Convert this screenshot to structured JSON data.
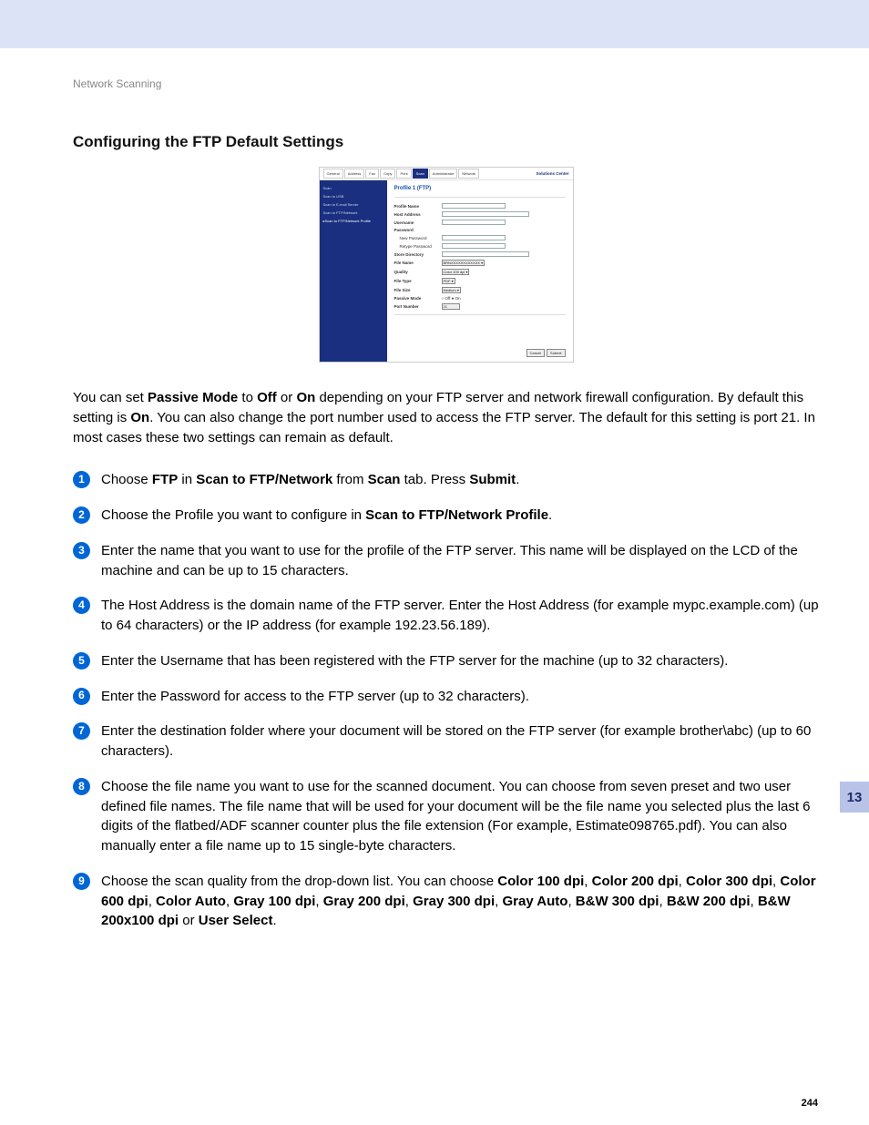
{
  "breadcrumb": "Network Scanning",
  "heading": "Configuring the FTP Default Settings",
  "side_tab": "13",
  "page_number": "244",
  "screenshot_ui": {
    "tabs": [
      "General",
      "Address",
      "Fax",
      "Copy",
      "Print",
      "Scan",
      "Administrator",
      "Network"
    ],
    "active_tab": "Scan",
    "logo": "Solutions Center",
    "sidebar": [
      "Scan",
      "Scan to USB",
      "Scan to E-mail Server",
      "Scan to FTP/Network",
      "▸Scan to FTP/Network Profile"
    ],
    "panel_title": "Profile 1 (FTP)",
    "fields": {
      "profile_name_lbl": "Profile Name",
      "host_address_lbl": "Host Address",
      "username_lbl": "Username",
      "password_lbl": "Password",
      "new_password_lbl": "New Password",
      "retype_password_lbl": "Retype Password",
      "store_directory_lbl": "Store Directory",
      "file_name_lbl": "File Name",
      "file_name_val": "BRNXXXXXXXXXXXX ▾",
      "quality_lbl": "Quality",
      "quality_val": "Color 100 dpi ▾",
      "file_type_lbl": "File Type",
      "file_type_val": "PDF ▾",
      "file_size_lbl": "File Size",
      "file_size_val": "Medium ▾",
      "passive_mode_lbl": "Passive Mode",
      "passive_mode_val": "○ Off  ● On",
      "port_number_lbl": "Port Number",
      "port_number_val": "21"
    },
    "buttons": {
      "cancel": "Cancel",
      "submit": "Submit"
    }
  },
  "intro_pre": "You can set ",
  "intro_b1": "Passive Mode",
  "intro_mid1": " to ",
  "intro_b2": "Off",
  "intro_mid2": " or ",
  "intro_b3": "On",
  "intro_mid3": " depending on your FTP server and network firewall configuration. By default this setting is ",
  "intro_b4": "On",
  "intro_post": ". You can also change the port number used to access the FTP server. The default for this setting is port 21. In most cases these two settings can remain as default.",
  "steps": {
    "s1": {
      "a": "Choose ",
      "b1": "FTP",
      "b": " in ",
      "b2": "Scan to FTP/Network",
      "c": " from ",
      "b3": "Scan",
      "d": " tab. Press ",
      "b4": "Submit",
      "e": "."
    },
    "s2": {
      "a": "Choose the Profile you want to configure in ",
      "b1": "Scan to FTP/Network Profile",
      "b": "."
    },
    "s3": "Enter the name that you want to use for the profile of the FTP server. This name will be displayed on the LCD of the machine and can be up to 15 characters.",
    "s4": "The Host Address is the domain name of the FTP server. Enter the Host Address (for example mypc.example.com) (up to 64 characters) or the IP address (for example 192.23.56.189).",
    "s5": "Enter the Username that has been registered with the FTP server for the machine (up to 32 characters).",
    "s6": "Enter the Password for access to the FTP server (up to 32 characters).",
    "s7": "Enter the destination folder where your document will be stored on the FTP server (for example brother\\abc) (up to 60 characters).",
    "s8": "Choose the file name you want to use for the scanned document. You can choose from seven preset and two user defined file names. The file name that will be used for your document will be the file name you selected plus the last 6 digits of the flatbed/ADF scanner counter plus the file extension (For example, Estimate098765.pdf). You can also manually enter a file name up to 15 single-byte characters.",
    "s9": {
      "a": "Choose the scan quality from the drop-down list. You can choose ",
      "opts": [
        "Color 100 dpi",
        "Color 200 dpi",
        "Color 300 dpi",
        "Color 600 dpi",
        "Color Auto",
        "Gray 100 dpi",
        "Gray 200 dpi",
        "Gray 300 dpi",
        "Gray Auto",
        "B&W 300 dpi",
        "B&W 200 dpi",
        "B&W 200x100 dpi"
      ],
      "or": " or ",
      "last": "User Select",
      "end": "."
    }
  }
}
